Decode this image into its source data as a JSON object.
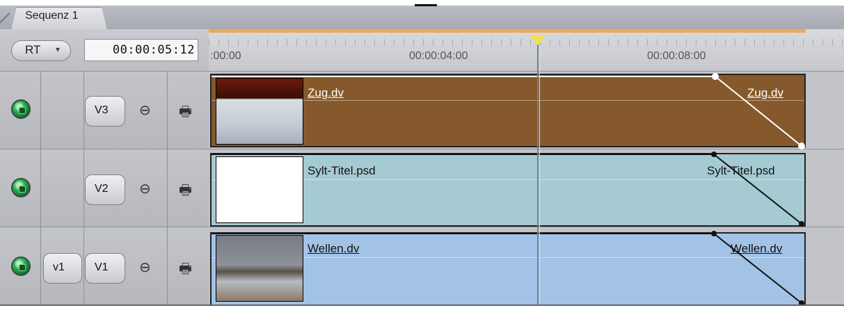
{
  "tab": {
    "label": "Sequenz 1"
  },
  "controls": {
    "rt_label": "RT",
    "rt_arrow": "▾",
    "timecode": "00:00:05:12"
  },
  "ruler": {
    "labels": [
      ":00:00",
      "00:00:04:00",
      "00:00:08:00"
    ],
    "accent_color": "#f0a65c",
    "playhead_color": "#f3e04b"
  },
  "tracks": [
    {
      "name": "V3",
      "source_label": "",
      "lock_icon": "lock-icon",
      "link_icon": "print-icon",
      "clip": {
        "label_start": "Zug.dv",
        "label_end": "Zug.dv",
        "color": "#85592b"
      }
    },
    {
      "name": "V2",
      "source_label": "",
      "lock_icon": "lock-icon",
      "link_icon": "print-icon",
      "clip": {
        "label_start": "Sylt-Titel.psd",
        "label_end": "Sylt-Titel.psd",
        "color": "#a5cad3"
      }
    },
    {
      "name": "V1",
      "source_label": "v1",
      "lock_icon": "lock-icon",
      "link_icon": "print-icon",
      "clip": {
        "label_start": "Wellen.dv",
        "label_end": "Wellen.dv",
        "color": "#a3c3e6"
      }
    }
  ]
}
